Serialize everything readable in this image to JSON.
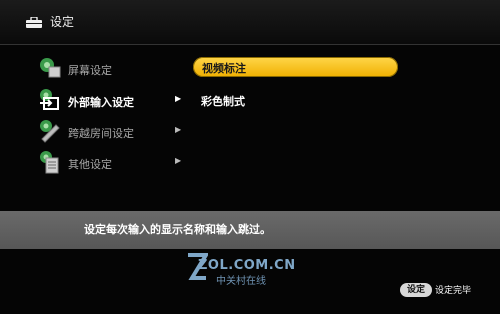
{
  "header": {
    "title": "设定",
    "icon": "toolbox-icon"
  },
  "menu": {
    "items": [
      {
        "label": "屏幕设定",
        "icon": "screen-settings-icon",
        "state": "dim",
        "has_arrow": false
      },
      {
        "label": "外部输入设定",
        "icon": "external-input-icon",
        "state": "active",
        "has_arrow": true
      },
      {
        "label": "跨越房间设定",
        "icon": "room-link-icon",
        "state": "dim",
        "has_arrow": true
      },
      {
        "label": "其他设定",
        "icon": "other-settings-icon",
        "state": "dim",
        "has_arrow": true
      }
    ],
    "arrow_glyph": "▶"
  },
  "submenu": {
    "selected_option": "视频标注",
    "options": [
      "彩色制式"
    ]
  },
  "info": {
    "text": "设定每次输入的显示名称和输入跳过。"
  },
  "watermark": {
    "main": "ZOL.COM.CN",
    "sub": "中关村在线"
  },
  "footer": {
    "key_label": "设定",
    "key_text": "设定完毕"
  },
  "colors": {
    "highlight": "#f5c21a",
    "info_bar": "#616161",
    "background": "#050505"
  }
}
